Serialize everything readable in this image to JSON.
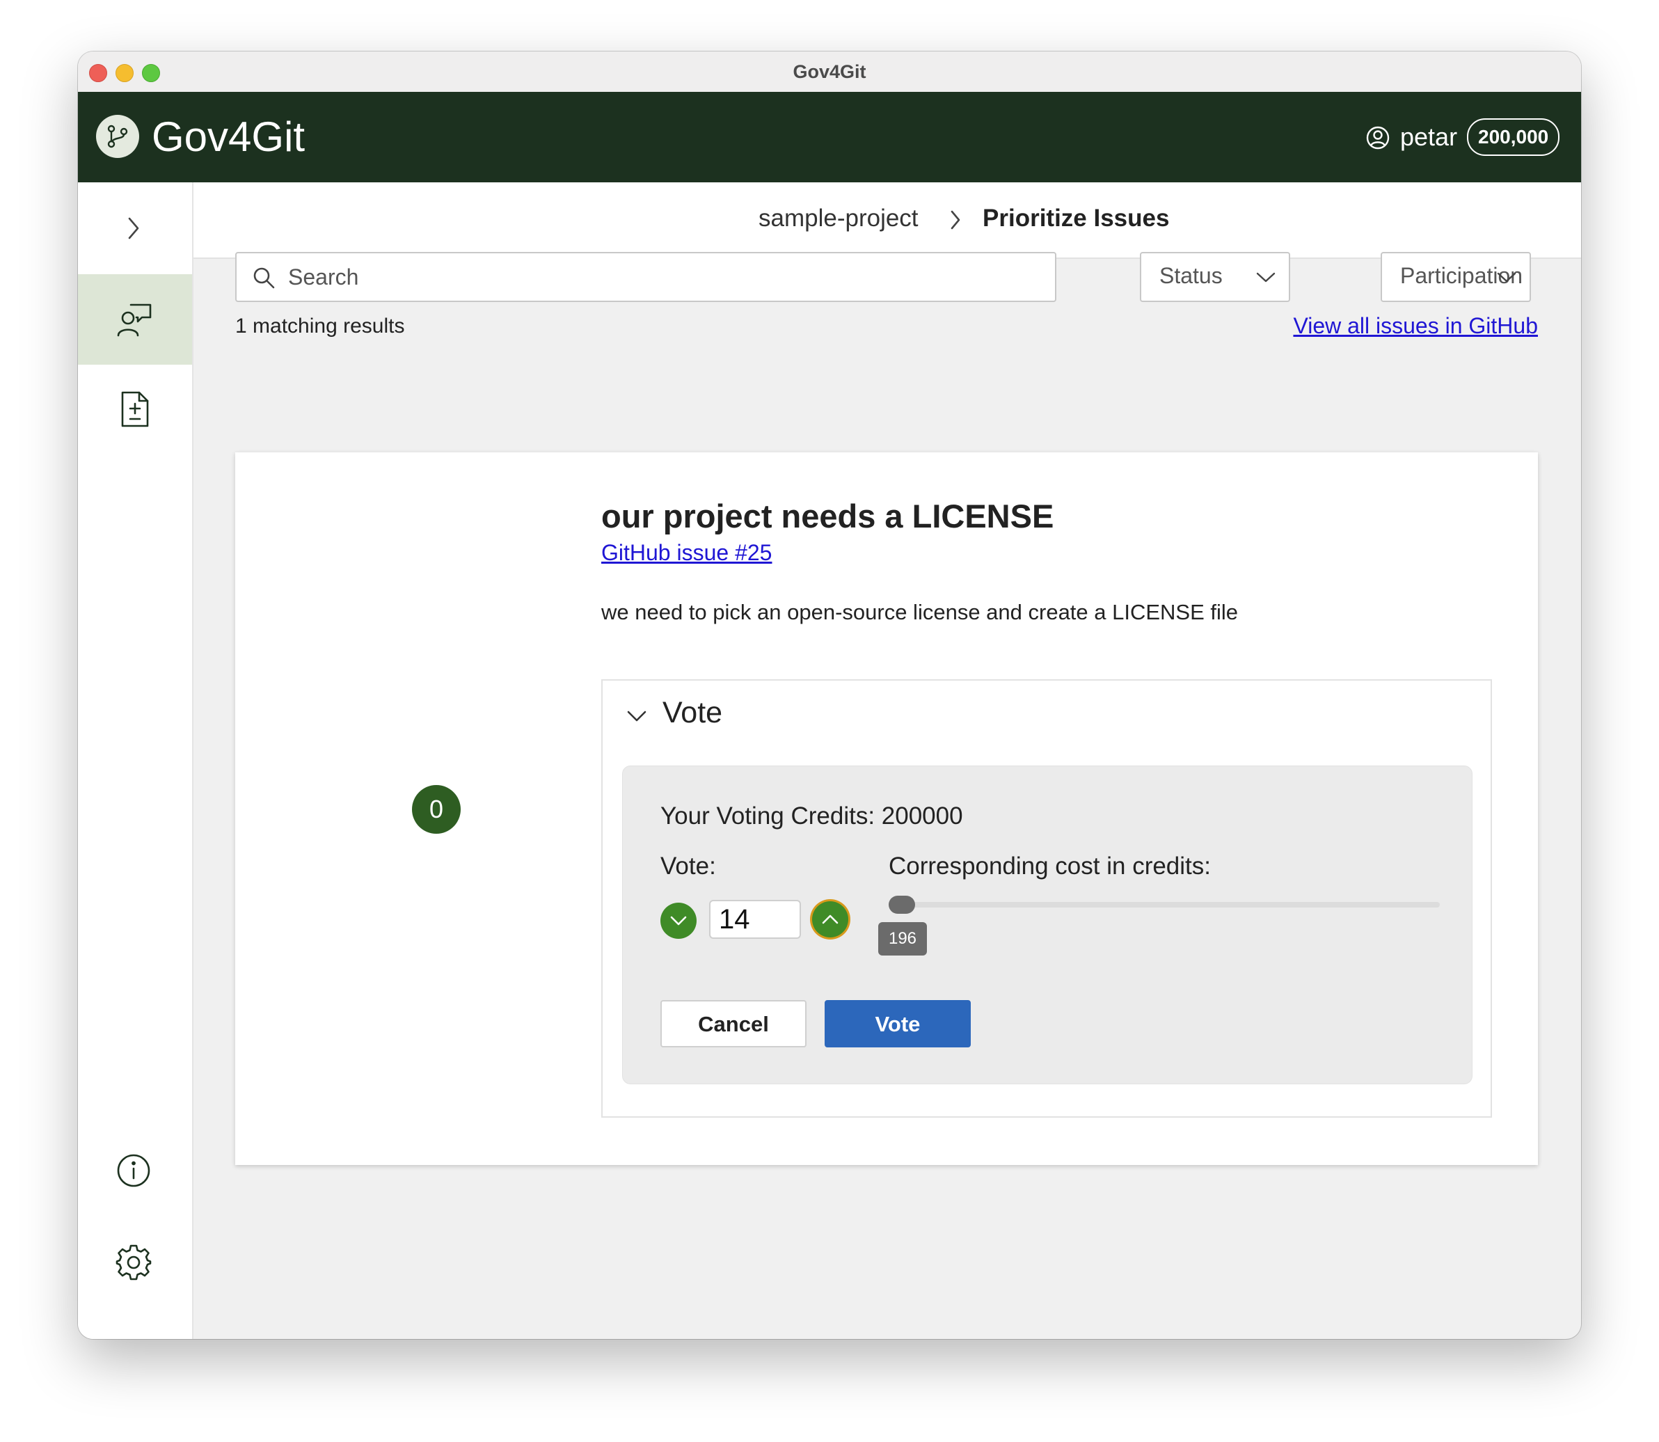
{
  "window": {
    "title": "Gov4Git"
  },
  "app": {
    "name": "Gov4Git"
  },
  "user": {
    "name": "petar",
    "credits": "200,000"
  },
  "breadcrumb": {
    "project": "sample-project",
    "page": "Prioritize Issues"
  },
  "filters": {
    "search_placeholder": "Search",
    "status_label": "Status",
    "participation_label": "Participation"
  },
  "results": {
    "count_text": "1 matching results",
    "github_link": "View all issues in GitHub"
  },
  "issue": {
    "score": "0",
    "title": "our project needs a LICENSE",
    "link_text": "GitHub issue #25",
    "description": "we need to pick an open-source license and create a LICENSE file"
  },
  "vote": {
    "heading": "Vote",
    "voting_credits": "Your Voting Credits: 200000",
    "vote_label": "Vote:",
    "cost_label": "Corresponding cost in credits:",
    "vote_value": "14",
    "cost_value": "196",
    "cancel_label": "Cancel",
    "submit_label": "Vote"
  },
  "colors": {
    "appbar": "#1c311f",
    "sidebar_active": "#dde6d6",
    "score_badge": "#2e5d22",
    "stepper": "#3f8b27",
    "stepper_focus": "#d89a1c",
    "primary_button": "#2c67bb",
    "link": "#1f16d4"
  },
  "icons": {
    "logo": "git-branch-icon",
    "user": "user-circle-icon",
    "sidebar_toggle": "chevron-right-icon",
    "nav_issues": "person-feedback-icon",
    "nav_proposals": "document-diff-icon",
    "info": "info-icon",
    "settings": "gear-icon",
    "refresh": "refresh-icon",
    "search": "search-icon"
  }
}
